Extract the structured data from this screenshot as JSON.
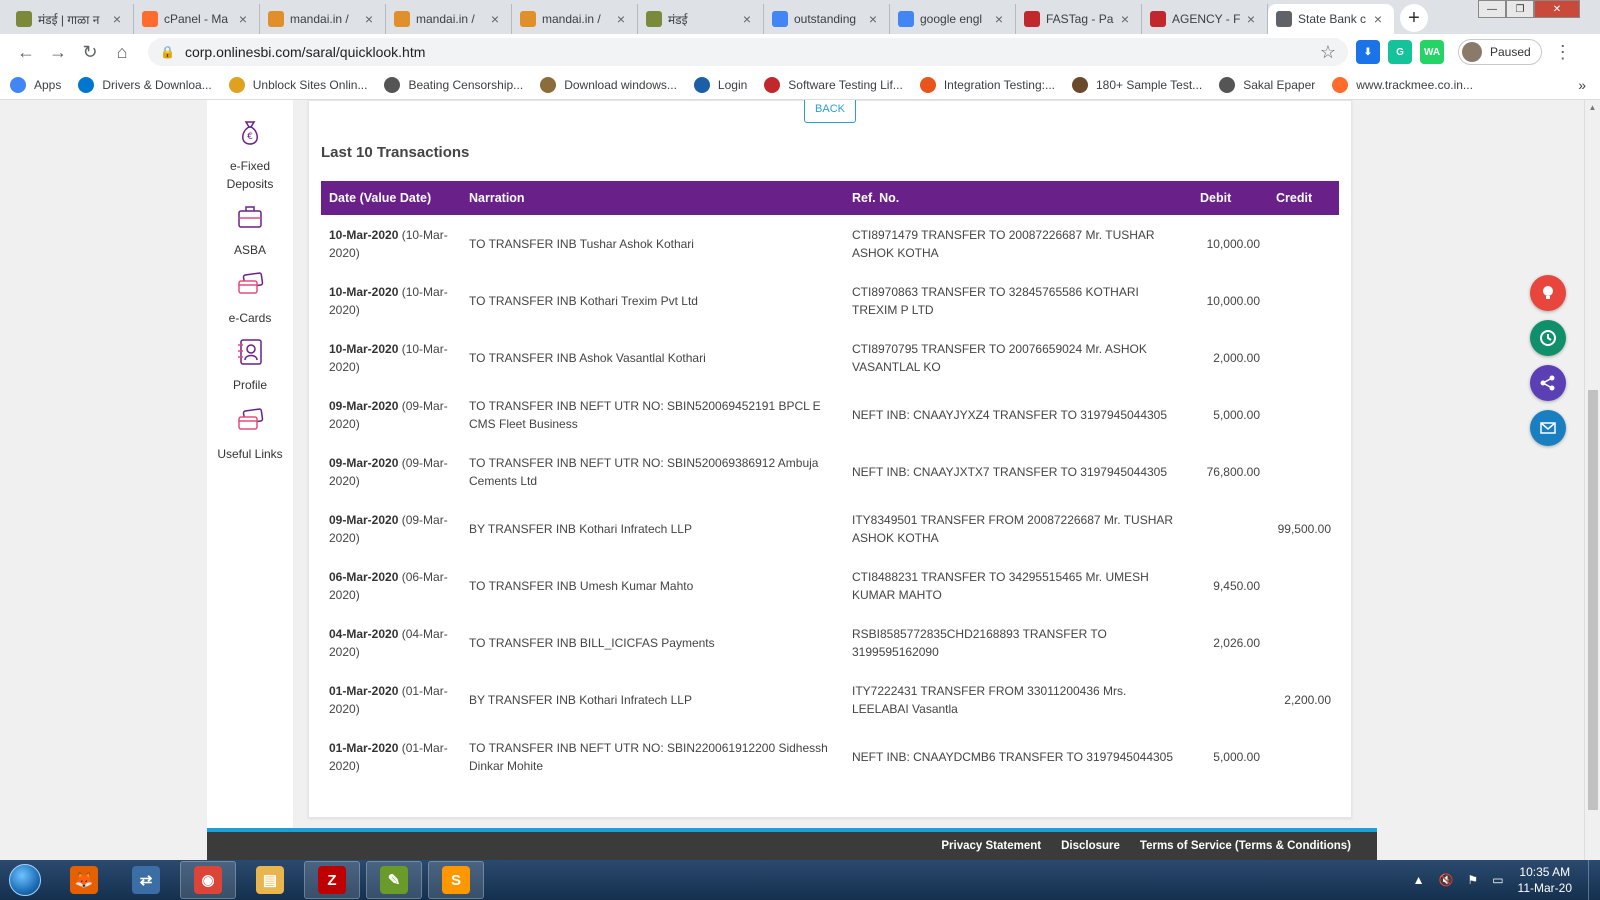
{
  "browser": {
    "tabs": [
      {
        "label": "मंडई | गाळा न",
        "icon": "mandai-icon",
        "color": "#7a8a3a",
        "active": false
      },
      {
        "label": "cPanel - Ma",
        "icon": "cpanel-icon",
        "color": "#ff6c2c",
        "active": false
      },
      {
        "label": "mandai.in /",
        "icon": "mandai-icon",
        "color": "#e0902a",
        "active": false
      },
      {
        "label": "mandai.in /",
        "icon": "mandai-icon",
        "color": "#e0902a",
        "active": false
      },
      {
        "label": "mandai.in /",
        "icon": "mandai-icon",
        "color": "#e0902a",
        "active": false
      },
      {
        "label": "मंडई",
        "icon": "mandai-icon",
        "color": "#7a8a3a",
        "active": false
      },
      {
        "label": "outstanding",
        "icon": "google-icon",
        "color": "#4285f4",
        "active": false
      },
      {
        "label": "google engl",
        "icon": "google-icon",
        "color": "#4285f4",
        "active": false
      },
      {
        "label": "FASTag - Pa",
        "icon": "fastag-icon",
        "color": "#c0282d",
        "active": false
      },
      {
        "label": "AGENCY - F",
        "icon": "agency-icon",
        "color": "#c0282d",
        "active": false
      },
      {
        "label": "State Bank c",
        "icon": "globe-icon",
        "color": "#5f6368",
        "active": true
      }
    ],
    "url": "corp.onlinesbi.com/saral/quicklook.htm",
    "profile_label": "Paused",
    "extensions": [
      {
        "name": "extension-download-icon",
        "glyph": "⬇",
        "color": "#1a73e8"
      },
      {
        "name": "grammarly-icon",
        "glyph": "G",
        "color": "#15c39a"
      },
      {
        "name": "whatsapp-icon",
        "glyph": "WA",
        "color": "#25d366"
      }
    ],
    "bookmarks": [
      {
        "label": "Apps",
        "color": "#4285f4"
      },
      {
        "label": "Drivers & Downloa...",
        "color": "#0076ce"
      },
      {
        "label": "Unblock Sites Onlin...",
        "color": "#e0a020"
      },
      {
        "label": "Beating Censorship...",
        "color": "#555555"
      },
      {
        "label": "Download windows...",
        "color": "#8a6d3b"
      },
      {
        "label": "Login",
        "color": "#1a5fa8"
      },
      {
        "label": "Software Testing Lif...",
        "color": "#c0282d"
      },
      {
        "label": "Integration Testing:...",
        "color": "#e8541c"
      },
      {
        "label": "180+ Sample Test...",
        "color": "#6b4a2b"
      },
      {
        "label": "Sakal Epaper",
        "color": "#555555"
      },
      {
        "label": "www.trackmee.co.in...",
        "color": "#ff6c2c"
      }
    ]
  },
  "sidebar": {
    "items": [
      {
        "label1": "e-Fixed",
        "label2": "Deposits",
        "icon": "money-bag-icon"
      },
      {
        "label1": "ASBA",
        "label2": "",
        "icon": "briefcase-icon"
      },
      {
        "label1": "e-Cards",
        "label2": "",
        "icon": "cards-icon"
      },
      {
        "label1": "Profile",
        "label2": "",
        "icon": "profile-icon"
      },
      {
        "label1": "Useful Links",
        "label2": "",
        "icon": "links-icon"
      }
    ]
  },
  "main": {
    "back_label": "BACK",
    "title": "Last 10 Transactions",
    "columns": [
      "Date (Value Date)",
      "Narration",
      "Ref. No.",
      "Debit",
      "Credit"
    ],
    "rows": [
      {
        "date": "10-Mar-2020",
        "value_date": " (10-Mar-2020)",
        "narration": "TO TRANSFER INB Tushar Ashok Kothari",
        "ref": "CTI8971479 TRANSFER TO 20087226687 Mr. TUSHAR ASHOK KOTHA",
        "debit": "10,000.00",
        "credit": ""
      },
      {
        "date": "10-Mar-2020",
        "value_date": " (10-Mar-2020)",
        "narration": "TO TRANSFER INB Kothari Trexim Pvt Ltd",
        "ref": "CTI8970863 TRANSFER TO 32845765586 KOTHARI TREXIM P LTD",
        "debit": "10,000.00",
        "credit": ""
      },
      {
        "date": "10-Mar-2020",
        "value_date": " (10-Mar-2020)",
        "narration": "TO TRANSFER INB Ashok Vasantlal Kothari",
        "ref": "CTI8970795 TRANSFER TO 20076659024 Mr. ASHOK VASANTLAL KO",
        "debit": "2,000.00",
        "credit": ""
      },
      {
        "date": "09-Mar-2020",
        "value_date": " (09-Mar-2020)",
        "narration": "TO TRANSFER INB NEFT UTR NO: SBIN520069452191 BPCL E CMS Fleet Business",
        "ref": "NEFT INB: CNAAYJYXZ4 TRANSFER TO 3197945044305",
        "debit": "5,000.00",
        "credit": ""
      },
      {
        "date": "09-Mar-2020",
        "value_date": " (09-Mar-2020)",
        "narration": "TO TRANSFER INB NEFT UTR NO: SBIN520069386912 Ambuja Cements Ltd",
        "ref": "NEFT INB: CNAAYJXTX7 TRANSFER TO 3197945044305",
        "debit": "76,800.00",
        "credit": ""
      },
      {
        "date": "09-Mar-2020",
        "value_date": " (09-Mar-2020)",
        "narration": "BY TRANSFER INB Kothari Infratech LLP",
        "ref": "ITY8349501 TRANSFER FROM 20087226687 Mr. TUSHAR ASHOK KOTHA",
        "debit": "",
        "credit": "99,500.00"
      },
      {
        "date": "06-Mar-2020",
        "value_date": " (06-Mar-2020)",
        "narration": "TO TRANSFER INB Umesh Kumar Mahto",
        "ref": "CTI8488231 TRANSFER TO 34295515465 Mr. UMESH KUMAR MAHTO",
        "debit": "9,450.00",
        "credit": ""
      },
      {
        "date": "04-Mar-2020",
        "value_date": " (04-Mar-2020)",
        "narration": "TO TRANSFER INB BILL_ICICFAS Payments",
        "ref": "RSBI8585772835CHD2168893 TRANSFER TO 3199595162090",
        "debit": "2,026.00",
        "credit": ""
      },
      {
        "date": "01-Mar-2020",
        "value_date": " (01-Mar-2020)",
        "narration": "BY TRANSFER INB Kothari Infratech LLP",
        "ref": "ITY7222431 TRANSFER FROM 33011200436 Mrs. LEELABAI Vasantla",
        "debit": "",
        "credit": "2,200.00"
      },
      {
        "date": "01-Mar-2020",
        "value_date": " (01-Mar-2020)",
        "narration": "TO TRANSFER INB NEFT UTR NO: SBIN220061912200 Sidhessh Dinkar Mohite",
        "ref": "NEFT INB: CNAAYDCMB6 TRANSFER TO 3197945044305",
        "debit": "5,000.00",
        "credit": ""
      }
    ]
  },
  "footer": {
    "links": [
      "Privacy Statement",
      "Disclosure",
      "Terms of Service (Terms & Conditions)"
    ]
  },
  "taskbar": {
    "apps": [
      {
        "name": "firefox-icon",
        "glyph": "🦊",
        "color": "#e66000",
        "open": false
      },
      {
        "name": "network-icon",
        "glyph": "⇄",
        "color": "#3a6ea5",
        "open": false
      },
      {
        "name": "chrome-icon",
        "glyph": "◉",
        "color": "#db4437",
        "open": true
      },
      {
        "name": "folder-icon",
        "glyph": "▤",
        "color": "#e8b64c",
        "open": false
      },
      {
        "name": "filezilla-icon",
        "glyph": "Z",
        "color": "#bf0000",
        "open": true
      },
      {
        "name": "notepad-icon",
        "glyph": "✎",
        "color": "#6a9a2a",
        "open": true
      },
      {
        "name": "sublime-icon",
        "glyph": "S",
        "color": "#ff9800",
        "open": true
      }
    ],
    "time": "10:35 AM",
    "date": "11-Mar-20"
  },
  "colors": {
    "table_header": "#6a2089",
    "footer_accent": "#1ba1d8",
    "footer_bg": "#3b3b3b"
  }
}
